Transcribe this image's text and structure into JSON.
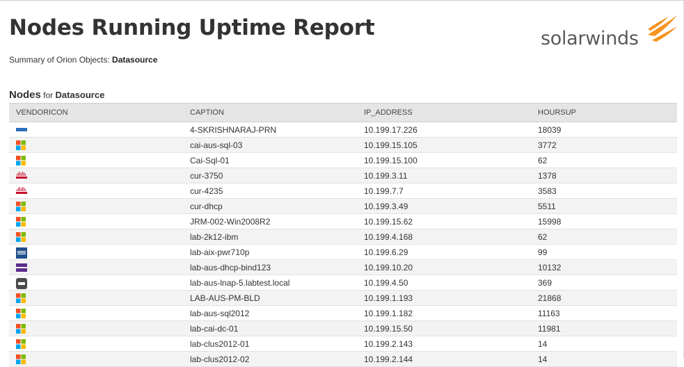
{
  "report": {
    "title": "Nodes Running Uptime Report",
    "summary_prefix": "Summary of Orion Objects: ",
    "summary_value": "Datasource"
  },
  "logo": {
    "text": "solarwinds",
    "color": "#f7931e"
  },
  "section": {
    "heading": "Nodes",
    "for_text": " for ",
    "datasource": "Datasource"
  },
  "table": {
    "columns": [
      "VENDORICON",
      "CAPTION",
      "IP_ADDRESS",
      "HOURSUP"
    ],
    "rows": [
      {
        "icon": "dell-icon",
        "caption": "4-SKRISHNARAJ-PRN",
        "ip": "10.199.17.226",
        "hours": "18039"
      },
      {
        "icon": "windows-icon",
        "caption": "cai-aus-sql-03",
        "ip": "10.199.15.105",
        "hours": "3772"
      },
      {
        "icon": "windows-icon",
        "caption": "Cai-Sql-01",
        "ip": "10.199.15.100",
        "hours": "62"
      },
      {
        "icon": "cisco-icon",
        "caption": "cur-3750",
        "ip": "10.199.3.11",
        "hours": "1378"
      },
      {
        "icon": "cisco-icon",
        "caption": "cur-4235",
        "ip": "10.199.7.7",
        "hours": "3583"
      },
      {
        "icon": "windows-icon",
        "caption": "cur-dhcp",
        "ip": "10.199.3.49",
        "hours": "5511"
      },
      {
        "icon": "windows-icon",
        "caption": "JRM-002-Win2008R2",
        "ip": "10.199.15.62",
        "hours": "15998"
      },
      {
        "icon": "windows-icon",
        "caption": "lab-2k12-ibm",
        "ip": "10.199.4.168",
        "hours": "62"
      },
      {
        "icon": "ibm-icon",
        "caption": "lab-aix-pwr710p",
        "ip": "10.199.6.29",
        "hours": "99"
      },
      {
        "icon": "net-snmp-icon",
        "caption": "lab-aus-dhcp-bind123",
        "ip": "10.199.10.20",
        "hours": "10132"
      },
      {
        "icon": "vmware-icon",
        "caption": "lab-aus-lnap-5.labtest.local",
        "ip": "10.199.4.50",
        "hours": "369"
      },
      {
        "icon": "windows-icon",
        "caption": "LAB-AUS-PM-BLD",
        "ip": "10.199.1.193",
        "hours": "21868"
      },
      {
        "icon": "windows-icon",
        "caption": "lab-aus-sql2012",
        "ip": "10.199.1.182",
        "hours": "11163"
      },
      {
        "icon": "windows-icon",
        "caption": "lab-cai-dc-01",
        "ip": "10.199.15.50",
        "hours": "11981"
      },
      {
        "icon": "windows-icon",
        "caption": "lab-clus2012-01",
        "ip": "10.199.2.143",
        "hours": "14"
      },
      {
        "icon": "windows-icon",
        "caption": "lab-clus2012-02",
        "ip": "10.199.2.144",
        "hours": "14"
      }
    ]
  }
}
